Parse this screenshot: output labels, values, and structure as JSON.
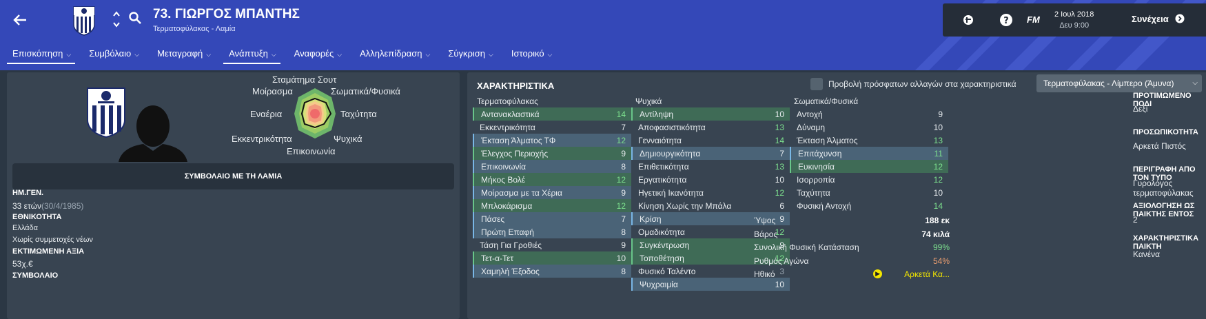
{
  "header": {
    "player_name": "73. ΓΙΩΡΓΟΣ ΜΠΑΝΤΗΣ",
    "player_sub": "Τερματοφύλακας - Λαμία",
    "date": "2 Ιουλ 2018",
    "time": "Δευ 9:00",
    "fm_label": "FM",
    "continue_label": "Συνέχεια",
    "icons": [
      "back-arrow-icon",
      "club-crest-icon",
      "up-down-arrows-icon",
      "search-icon",
      "social-icon",
      "help-icon",
      "fm-logo-icon",
      "continue-arrow-icon"
    ]
  },
  "tabs": [
    {
      "label": "Επισκόπηση"
    },
    {
      "label": "Συμβόλαιο"
    },
    {
      "label": "Μεταγραφή"
    },
    {
      "label": "Ανάπτυξη"
    },
    {
      "label": "Αναφορές"
    },
    {
      "label": "Αλληλεπίδραση"
    },
    {
      "label": "Σύγκριση"
    },
    {
      "label": "Ιστορικό"
    }
  ],
  "left": {
    "radar_labels": {
      "top": "Σταμάτημα Σουτ",
      "top_left": "Μοίρασμα",
      "top_right": "Σωματικά/Φυσικά",
      "left": "Εναέρια",
      "right": "Ταχύτητα",
      "bottom_left": "Εκκεντρικότητα",
      "bottom_right": "Ψυχικά",
      "bottom": "Επικοινωνία"
    },
    "contract_bar": "ΣΥΜΒΟΛΑΙΟ ΜΕ ΤΗ ΛΑΜΙΑ",
    "info": {
      "dob_h": "ΗΜ.ΓΕΝ.",
      "age": "33 ετών",
      "dob": "(30/4/1985)",
      "nat_h": "ΕΘΝΙΚΟΤΗΤΑ",
      "nat": "Ελλάδα",
      "caps": "Χωρίς συμμετοχές νέων",
      "value_h": "ΕΚΤΙΜΩΜΕΝΗ ΑΞΙΑ",
      "value": "53χ.€",
      "contract_h": "ΣΥΜΒΟΛΑΙΟ"
    }
  },
  "right": {
    "title": "ΧΑΡΑΚΤΗΡΙΣΤΙΚΑ",
    "toggle_label": "Προβολή πρόσφατων αλλαγών στα χαρακτηριστικά",
    "role_select": "Τερματοφύλακας - Λίμπερο (Άμυνα)",
    "col1_h": "Τερματοφύλακας",
    "col2_h": "Ψυχικά",
    "col3_h": "Σωματικά/Φυσικά",
    "goalkeeping": [
      {
        "n": "Αντανακλαστικά",
        "v": "14",
        "hl": "g"
      },
      {
        "n": "Εκκεντρικότητα",
        "v": "7",
        "hl": ""
      },
      {
        "n": "Έκταση Άλματος ΤΦ",
        "v": "12",
        "hl": "b"
      },
      {
        "n": "Έλεγχος Περιοχής",
        "v": "9",
        "hl": "g"
      },
      {
        "n": "Επικοινωνία",
        "v": "8",
        "hl": "b"
      },
      {
        "n": "Μήκος Βολέ",
        "v": "12",
        "hl": "g"
      },
      {
        "n": "Μοίρασμα με τα Χέρια",
        "v": "9",
        "hl": "b"
      },
      {
        "n": "Μπλοκάρισμα",
        "v": "12",
        "hl": "g"
      },
      {
        "n": "Πάσες",
        "v": "7",
        "hl": "b"
      },
      {
        "n": "Πρώτη Επαφή",
        "v": "8",
        "hl": "b"
      },
      {
        "n": "Τάση Για Γροθιές",
        "v": "9",
        "hl": ""
      },
      {
        "n": "Τετ-α-Τετ",
        "v": "10",
        "hl": "g"
      },
      {
        "n": "Χαμηλή Έξοδος",
        "v": "8",
        "hl": "b"
      }
    ],
    "mental": [
      {
        "n": "Αντίληψη",
        "v": "10",
        "hl": "g"
      },
      {
        "n": "Αποφασιστικότητα",
        "v": "13",
        "hl": ""
      },
      {
        "n": "Γενναιότητα",
        "v": "14",
        "hl": ""
      },
      {
        "n": "Δημιουργικότητα",
        "v": "7",
        "hl": "b"
      },
      {
        "n": "Επιθετικότητα",
        "v": "13",
        "hl": ""
      },
      {
        "n": "Εργατικότητα",
        "v": "10",
        "hl": ""
      },
      {
        "n": "Ηγετική Ικανότητα",
        "v": "12",
        "hl": ""
      },
      {
        "n": "Κίνηση Χωρίς την Μπάλα",
        "v": "6",
        "hl": ""
      },
      {
        "n": "Κρίση",
        "v": "9",
        "hl": "b"
      },
      {
        "n": "Ομαδικότητα",
        "v": "12",
        "hl": ""
      },
      {
        "n": "Συγκέντρωση",
        "v": "9",
        "hl": "g"
      },
      {
        "n": "Τοποθέτηση",
        "v": "12",
        "hl": "g"
      },
      {
        "n": "Φυσικό Ταλέντο",
        "v": "3",
        "hl": ""
      },
      {
        "n": "Ψυχραιμία",
        "v": "10",
        "hl": "b"
      }
    ],
    "physical": [
      {
        "n": "Αντοχή",
        "v": "9",
        "hl": ""
      },
      {
        "n": "Δύναμη",
        "v": "10",
        "hl": ""
      },
      {
        "n": "Έκταση Άλματος",
        "v": "13",
        "hl": ""
      },
      {
        "n": "Επιτάχυνση",
        "v": "11",
        "hl": "b"
      },
      {
        "n": "Ευκινησία",
        "v": "12",
        "hl": "g"
      },
      {
        "n": "Ισορροπία",
        "v": "12",
        "hl": ""
      },
      {
        "n": "Ταχύτητα",
        "v": "10",
        "hl": ""
      },
      {
        "n": "Φυσική Αντοχή",
        "v": "14",
        "hl": ""
      }
    ],
    "profile": [
      {
        "n": "Ύψος",
        "v": "188 εκ"
      },
      {
        "n": "Βάρος",
        "v": "74 κιλά"
      },
      {
        "n": "Συνολική Φυσική Κατάσταση",
        "v": "99%"
      },
      {
        "n": "Ρυθμός Αγώνα",
        "v": "54%"
      },
      {
        "n": "Ηθικό",
        "v": "Αρκετά Κα..."
      }
    ],
    "info": {
      "foot_h": "ΠΡΟΤΙΜΩΜΕΝΟ ΠΟΔΙ",
      "foot": "Δεξί",
      "pers_h": "ΠΡΟΣΩΠΙΚΟΤΗΤΑ",
      "pers": "Αρκετά Πιστός",
      "media_h": "ΠΕΡΙΓΡΑΦΗ ΑΠΟ ΤΟΝ ΤΥΠΟ",
      "media": "Γυρολόγος τερματοφύλακας",
      "rating_h": "ΑΞΙΟΛΟΓΗΣΗ ΩΣ ΠΑΙΚΤΗΣ ΕΝΤΟΣ",
      "rating": "2",
      "traits_h": "ΧΑΡΑΚΤΗΡΙΣΤΙΚΑ ΠΑΙΚΤΗ",
      "traits": "Κανένα"
    }
  },
  "colors": {
    "accent": "#3448b8",
    "panel": "#384451",
    "good": "#69c68a",
    "info": "#79b7e6",
    "fitness": "#7ee38f",
    "warn": "#f0a070",
    "morale": "#f3e600"
  }
}
